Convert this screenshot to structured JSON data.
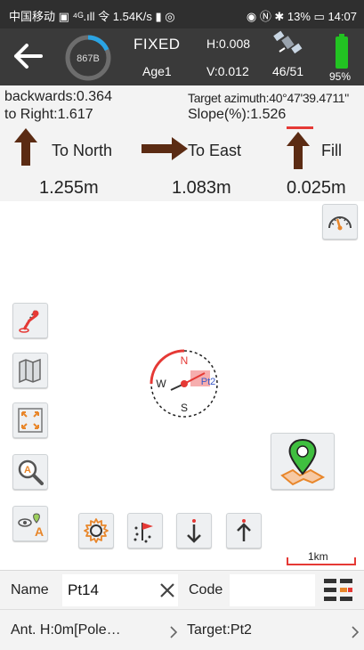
{
  "status": {
    "left": "中国移动 ▣ ⁴ᴳ.ıll 令 1.54K/s ▮ ◎",
    "right": "◉ Ⓝ ✱ 13% ▭ 14:07"
  },
  "gnss": {
    "dial_label": "867B",
    "solution": "FIXED",
    "age": "Age1",
    "h_prec": "H:0.008",
    "v_prec": "V:0.012",
    "satellites": "46/51",
    "battery": "95%"
  },
  "stake": {
    "backwards": "backwards:0.364",
    "to_right": "to Right:1.617",
    "target_azimuth": "Target azimuth:40°47'39.4711\"",
    "slope": "Slope(%):1.526",
    "north_label": "To North",
    "east_label": "To East",
    "fill_label": "Fill",
    "north_value": "1.255m",
    "east_value": "1.083m",
    "fill_value": "0.025m"
  },
  "map": {
    "compass": {
      "n": "N",
      "s": "S",
      "w": "W",
      "point_label": "Pt2"
    },
    "scale_label": "1km"
  },
  "namebar": {
    "name_label": "Name",
    "name_value": "Pt14",
    "code_label": "Code",
    "code_value": ""
  },
  "infobar": {
    "antenna": "Ant. H:0m[Pole…",
    "target": "Target:Pt2"
  },
  "colors": {
    "accent_orange": "#e8862a",
    "header_dark": "#3a3a3a",
    "battery_green": "#22c322",
    "alert_red": "#e53935",
    "arrow_brown": "#5b2b13"
  }
}
